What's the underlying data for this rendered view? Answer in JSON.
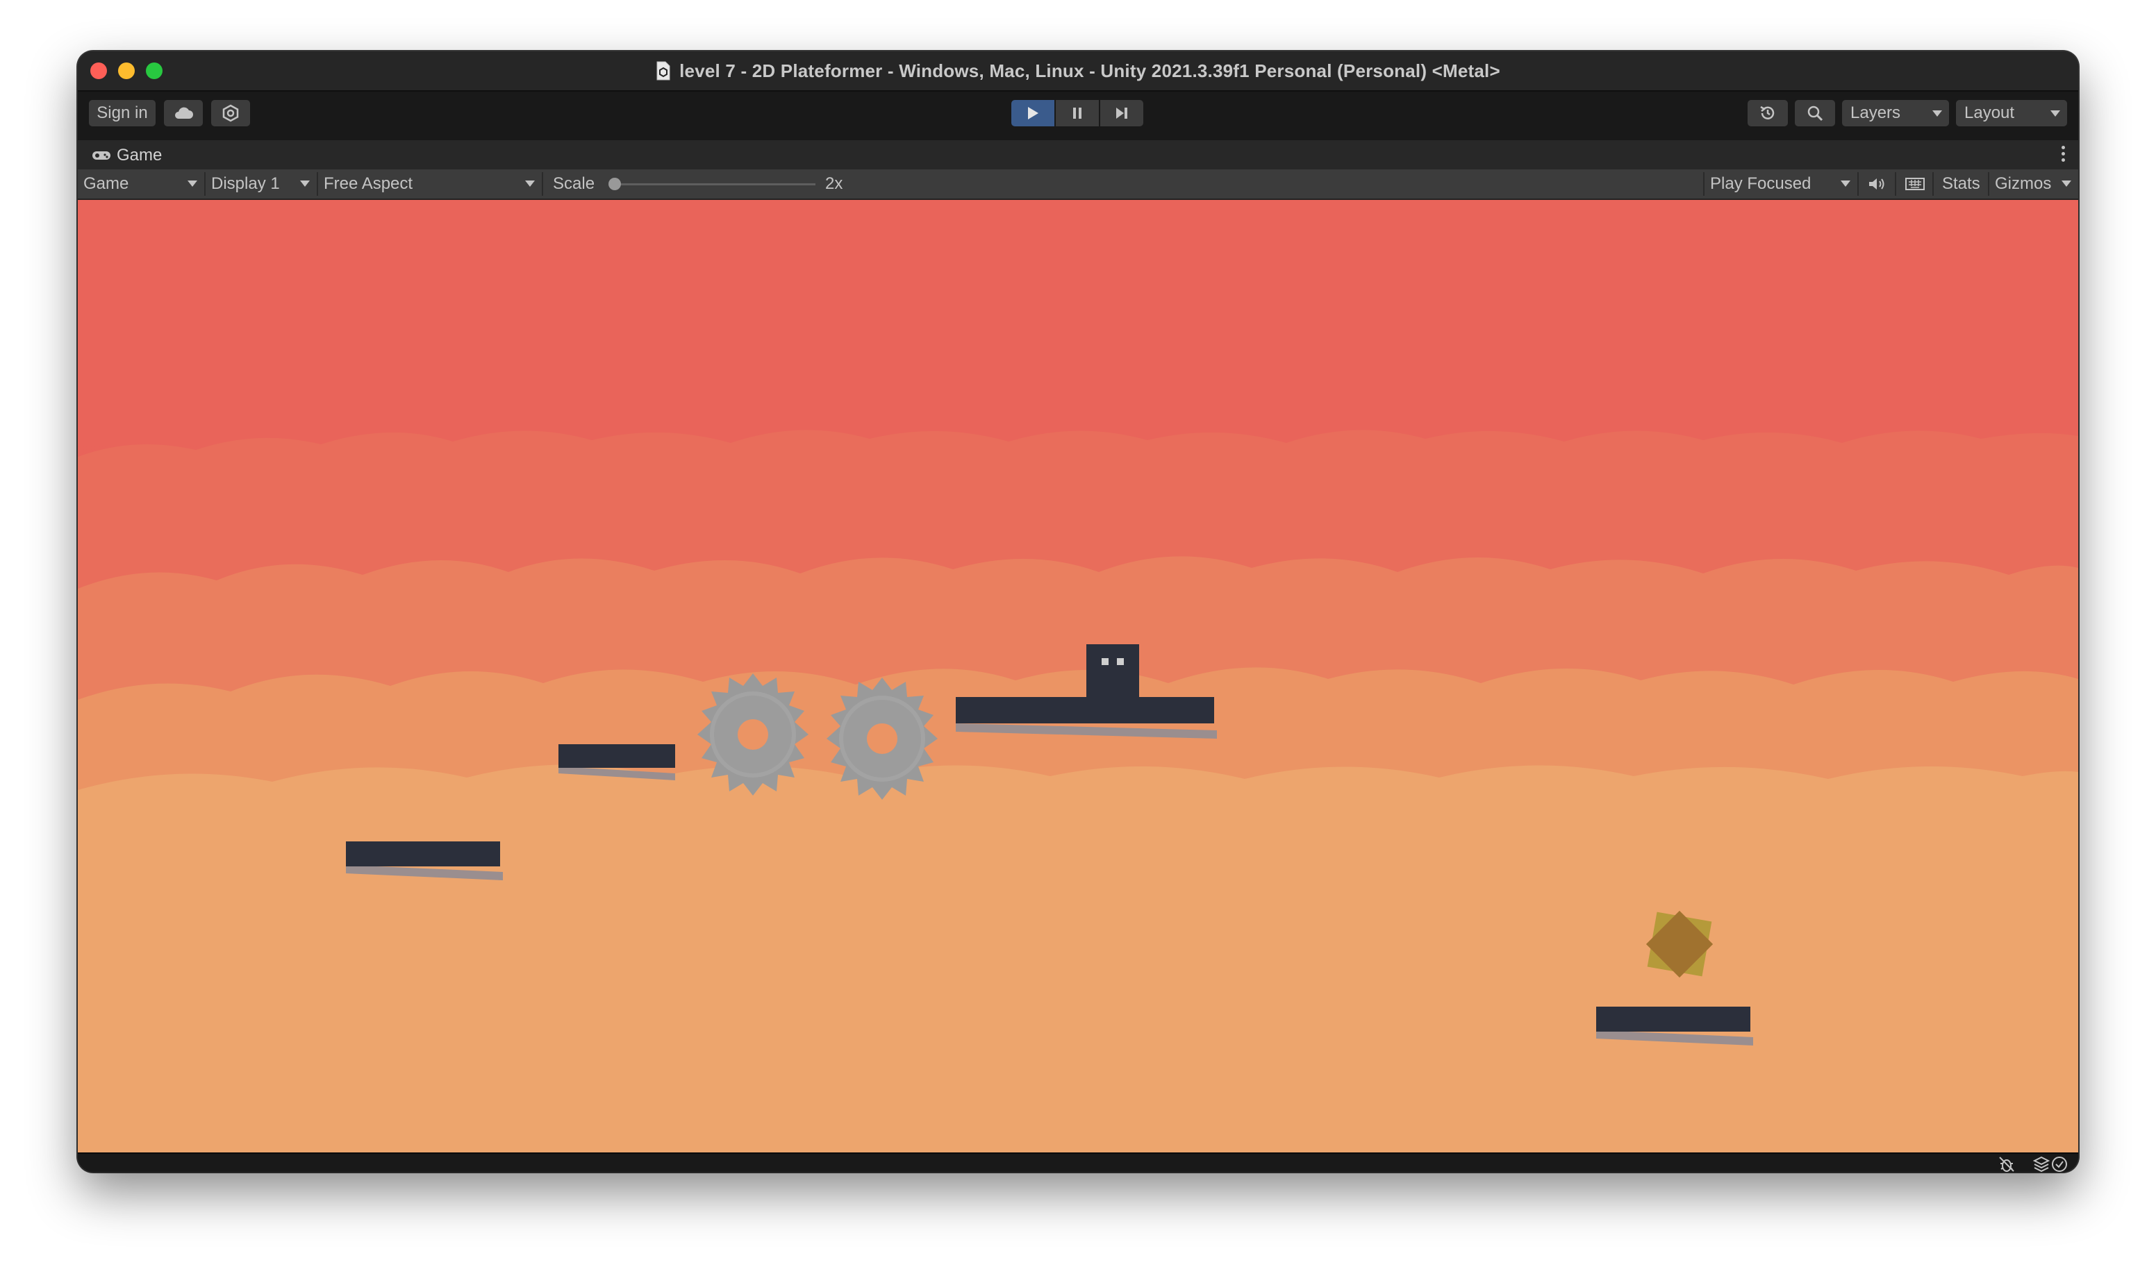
{
  "window": {
    "title": "level 7 - 2D Plateformer - Windows, Mac, Linux - Unity 2021.3.39f1 Personal (Personal) <Metal>"
  },
  "toolbar": {
    "sign_in_label": "Sign in",
    "cloud_icon": "cloud-icon",
    "collab_icon": "collab-icon",
    "play_active": true,
    "history_icon": "history-icon",
    "search_icon": "search-icon",
    "layers_label": "Layers",
    "layout_label": "Layout"
  },
  "game_tab": {
    "label": "Game",
    "icon": "gamepad-icon"
  },
  "game_controls": {
    "view_mode": "Game",
    "display": "Display 1",
    "aspect": "Free Aspect",
    "scale_label": "Scale",
    "scale_value": "2x",
    "scale_fraction": 0.0,
    "play_mode": "Play Focused",
    "audio_icon": "speaker-icon",
    "grid_icon": "keyboard-icon",
    "stats_label": "Stats",
    "gizmos_label": "Gizmos"
  },
  "scene": {
    "sky_color": "#e9645a",
    "ground_color": "#eda56d",
    "platform_color": "#2b2f3b",
    "saw_color": "#9a9a9a",
    "gem_color": "#a0722f",
    "objects": [
      "platform",
      "platform",
      "saw-blade",
      "saw-blade",
      "platform",
      "player",
      "platform",
      "goal-gem"
    ]
  },
  "statusbar": {
    "icons": [
      "bug-off-icon",
      "layers-stack-icon",
      "check-circle-icon"
    ]
  }
}
